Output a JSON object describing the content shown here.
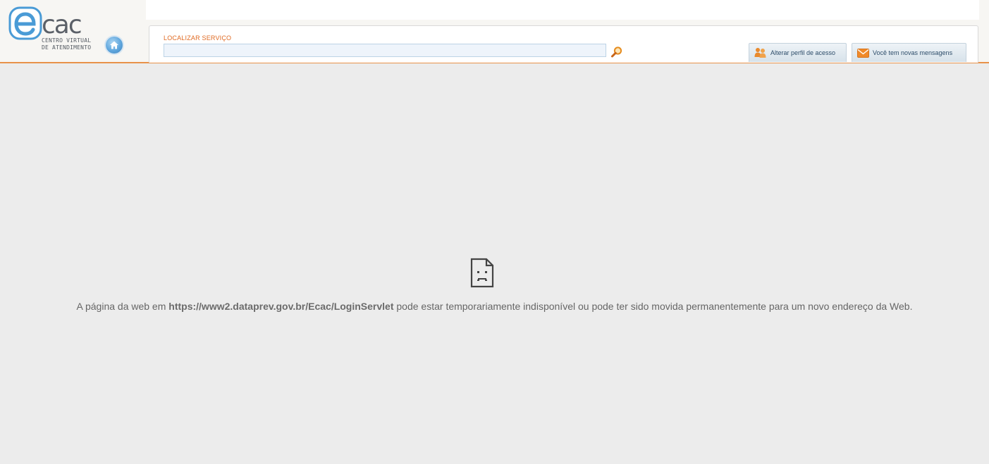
{
  "logo": {
    "text": "ecac",
    "tagline_line1": "CENTRO VIRTUAL",
    "tagline_line2": "DE ATENDIMENTO",
    "colors": {
      "primary": "#4a9bd6",
      "text": "#555b63"
    }
  },
  "home": {
    "icon": "home-icon"
  },
  "search": {
    "label": "LOCALIZAR SERVIÇO",
    "value": "",
    "placeholder": "",
    "icon": "magnifier-icon"
  },
  "header_buttons": {
    "profile_label": "Alterar perfil de acesso",
    "profile_icon": "users-icon",
    "messages_label": "Você tem novas mensagens",
    "messages_icon": "envelope-icon"
  },
  "error": {
    "icon": "sad-page-icon",
    "prefix": "A página da web em ",
    "url": "https://www2.dataprev.gov.br/Ecac/LoginServlet",
    "suffix": " pode estar temporariamente indisponível ou pode ter sido movida permanentemente para um novo endereço da Web."
  },
  "colors": {
    "accent": "#e8924a",
    "background": "#ececec",
    "search_label": "#e06a22"
  }
}
